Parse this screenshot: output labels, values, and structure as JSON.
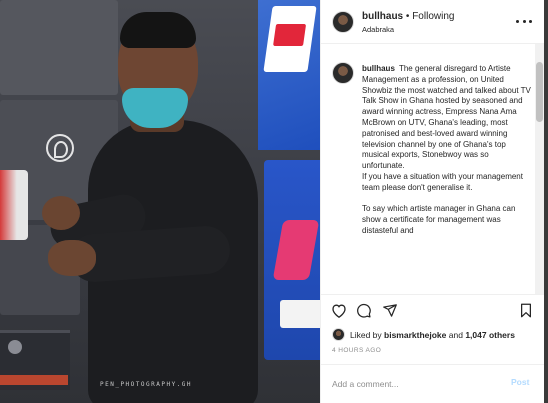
{
  "photo": {
    "credit": "PEN_PHOTOGRAPHY.GH"
  },
  "header": {
    "username": "bullhaus",
    "separator": "•",
    "follow_state": "Following",
    "location": "Adabraka",
    "more_icon": "more-horizontal-icon"
  },
  "caption": {
    "username": "bullhaus",
    "paragraph_1": "The general disregard to Artiste Management as a profession, on United Showbiz the most watched and talked about TV Talk Show in Ghana hosted by seasoned and award winning actress, Empress Nana Ama McBrown on UTV, Ghana's leading, most patronised and best-loved award winning television channel by one of Ghana's top musical exports, Stonebwoy was so unfortunate.",
    "paragraph_2": "If you have a situation with your management team please don't generalise it.",
    "paragraph_3": "To say which artiste manager in Ghana can show a certificate for management was distasteful and"
  },
  "actions": {
    "like_icon": "heart-icon",
    "comment_icon": "comment-icon",
    "share_icon": "paper-plane-icon",
    "save_icon": "bookmark-icon"
  },
  "likes": {
    "prefix": "Liked by ",
    "first_user": "bismarkthejoke",
    "joiner": " and ",
    "others": "1,047 others"
  },
  "timestamp": "4 HOURS AGO",
  "comment": {
    "placeholder": "Add a comment...",
    "post_label": "Post"
  },
  "colors": {
    "text": "#262626",
    "muted": "#8e8e8e",
    "post_disabled": "#b3dbff",
    "border": "#efefef"
  }
}
